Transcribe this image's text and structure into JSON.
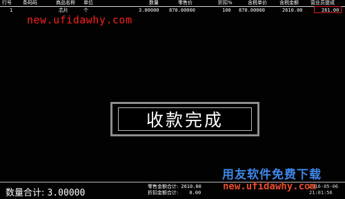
{
  "table": {
    "headers": [
      "行号",
      "条码码",
      "商品名称",
      "单位",
      "数量",
      "零售价",
      "折扣%",
      "含税单价",
      "含税金额",
      "营业员提成"
    ],
    "rows": [
      [
        "1",
        "",
        "芯片",
        "个",
        "3.00000",
        "870.00000",
        "100",
        "870.00000",
        "2610.00",
        "261.00"
      ]
    ]
  },
  "watermark": {
    "top_url": "new.ufidawhy.com",
    "bottom_cn": "用友软件免费下载",
    "bottom_url": "new.ufidawhy.com"
  },
  "dialog": {
    "message": "收款完成"
  },
  "status": {
    "qty_label": "数量合计:",
    "qty_value": "3.00000",
    "retail_total_label": "零售金额合计:",
    "retail_total_value": "2610.00",
    "discount_total_label": "折扣金额合计:",
    "discount_total_value": "0.00",
    "date": "2016-05-06",
    "time": "21:01:56"
  },
  "colors": {
    "background": "#000000",
    "highlight_box": "#e02020",
    "watermark_top": "#ff1e1e",
    "watermark_cn": "#3f86e6",
    "watermark_url": "#e84d2b"
  }
}
